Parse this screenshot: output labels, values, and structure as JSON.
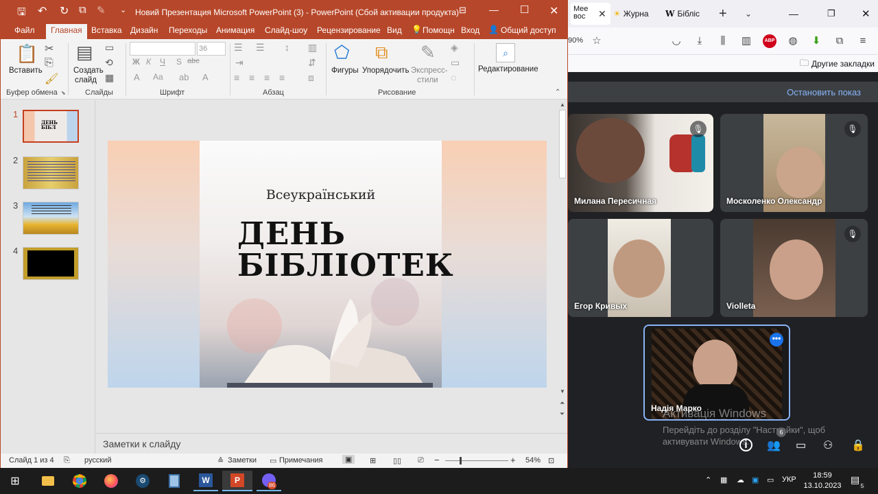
{
  "browser": {
    "tabs": [
      {
        "label": "Mee вос",
        "close": "✕"
      },
      {
        "label": "Журна"
      },
      {
        "label": "Бібліс"
      }
    ],
    "new_tab": "+",
    "zoom": "90%",
    "bookmarks_folder": "Другие закладки"
  },
  "meet": {
    "stop_presenting": "Остановить показ",
    "participants": [
      {
        "name": "Милана Пересичная",
        "muted": true
      },
      {
        "name": "Москоленко Олександр",
        "muted": true
      },
      {
        "name": "Егор Кривых",
        "muted": false
      },
      {
        "name": "Violleta",
        "muted": true
      },
      {
        "name": "Надія Марко",
        "muted": false
      }
    ],
    "people_count": "6"
  },
  "windows_activation": {
    "title": "Активація Windows",
    "line1": "Перейдіть до розділу \"Настройки\", щоб",
    "line2": "активувати Windows."
  },
  "ppt": {
    "window_title": "Новий Презентация Microsoft PowerPoint (3) - PowerPoint (Сбой активации продукта)",
    "ribbon_tabs": [
      "Файл",
      "Главная",
      "Вставка",
      "Дизайн",
      "Переходы",
      "Анимация",
      "Слайд-шоу",
      "Рецензирование",
      "Вид",
      "Помощн",
      "Вход",
      "Общий доступ"
    ],
    "active_tab": "Главная",
    "ribbon": {
      "paste": "Вставить",
      "new_slide_1": "Создать",
      "new_slide_2": "слайд",
      "font_size": "36",
      "shapes": "Фигуры",
      "arrange": "Упорядочить",
      "quick_styles_1": "Экспресс-",
      "quick_styles_2": "стили",
      "editing": "Редактирование",
      "groups": [
        "Буфер обмена",
        "Слайды",
        "Шрифт",
        "Абзац",
        "Рисование"
      ]
    },
    "slides": [
      {
        "num": "1"
      },
      {
        "num": "2"
      },
      {
        "num": "3"
      },
      {
        "num": "4"
      }
    ],
    "slide": {
      "subtitle": "Всеукраїнський",
      "title_line1": "ДЕНЬ",
      "title_line2": "БІБЛІОТЕК"
    },
    "notes_placeholder": "Заметки к слайду",
    "status": {
      "slide_of": "Слайд 1 из 4",
      "language": "русский",
      "notes": "Заметки",
      "comments": "Примечания",
      "zoom": "54%"
    }
  },
  "taskbar": {
    "language": "УКР",
    "time": "18:59",
    "date": "13.10.2023",
    "viber_badge": "86",
    "notif_count": "5"
  }
}
